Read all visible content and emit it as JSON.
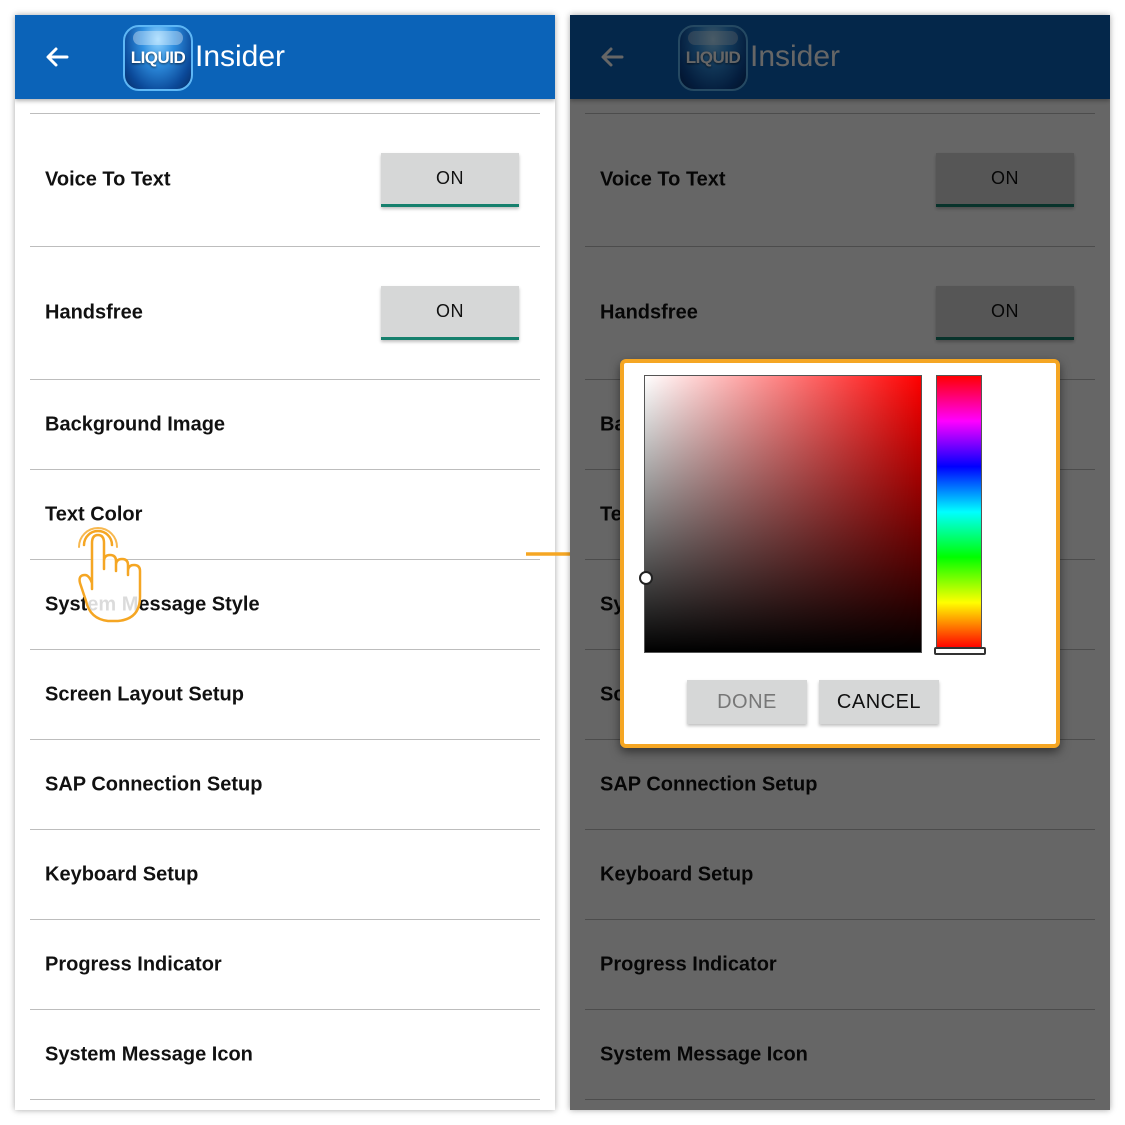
{
  "app": {
    "logo_text": "LIQUID",
    "title": "Insider"
  },
  "settings": [
    {
      "label": "Voice To Text",
      "toggle": "ON"
    },
    {
      "label": "Handsfree",
      "toggle": "ON"
    },
    {
      "label": "Background Image"
    },
    {
      "label": "Text Color"
    },
    {
      "label": "System Message Style"
    },
    {
      "label": "Screen Layout Setup"
    },
    {
      "label": "SAP Connection Setup"
    },
    {
      "label": "Keyboard Setup"
    },
    {
      "label": "Progress Indicator"
    },
    {
      "label": "System Message Icon"
    }
  ],
  "color_dialog": {
    "done_label": "DONE",
    "cancel_label": "CANCEL",
    "selected_hue_color": "#ff0000"
  },
  "colors": {
    "appbar": "#0b63b8",
    "toggle_underline": "#16806d",
    "highlight": "#f5a623"
  },
  "icons": {
    "back": "arrow-left-icon",
    "tap": "hand-tap-icon",
    "transition": "arrow-right-icon"
  }
}
